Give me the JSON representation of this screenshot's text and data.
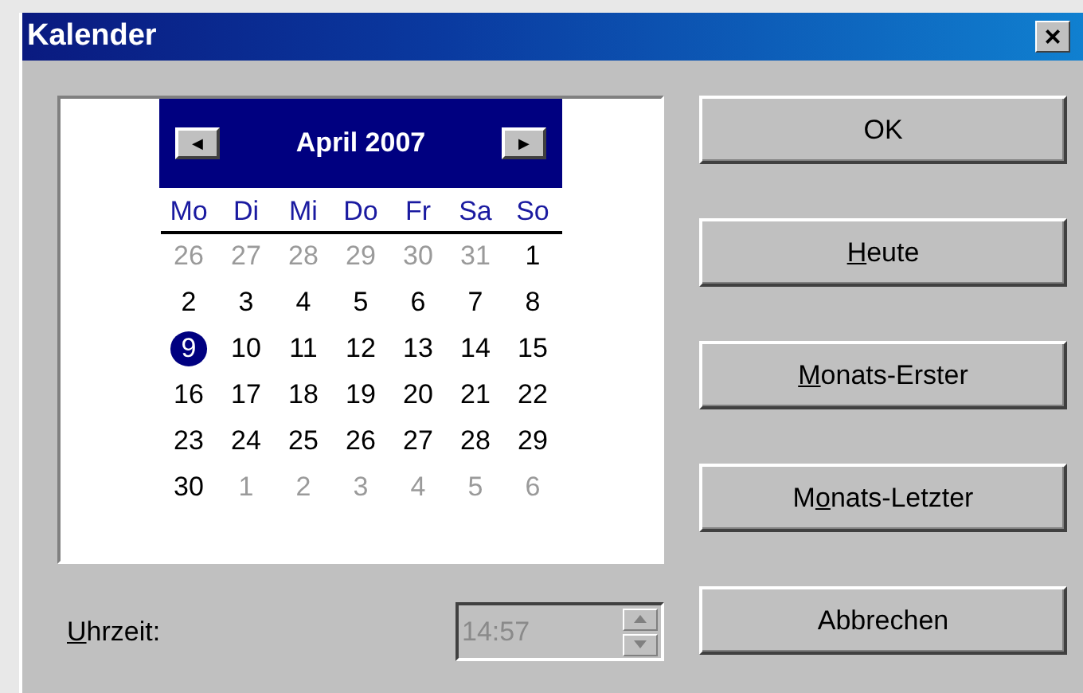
{
  "window": {
    "title": "Kalender",
    "close": "×"
  },
  "calendar": {
    "prev": "◀",
    "next": "▶",
    "month": "April 2007",
    "weekdays": [
      "Mo",
      "Di",
      "Mi",
      "Do",
      "Fr",
      "Sa",
      "So"
    ],
    "weeks": [
      [
        {
          "day": "26",
          "muted": true,
          "selected": false
        },
        {
          "day": "27",
          "muted": true,
          "selected": false
        },
        {
          "day": "28",
          "muted": true,
          "selected": false
        },
        {
          "day": "29",
          "muted": true,
          "selected": false
        },
        {
          "day": "30",
          "muted": true,
          "selected": false
        },
        {
          "day": "31",
          "muted": true,
          "selected": false
        },
        {
          "day": "1",
          "muted": false,
          "selected": false
        }
      ],
      [
        {
          "day": "2",
          "muted": false,
          "selected": false
        },
        {
          "day": "3",
          "muted": false,
          "selected": false
        },
        {
          "day": "4",
          "muted": false,
          "selected": false
        },
        {
          "day": "5",
          "muted": false,
          "selected": false
        },
        {
          "day": "6",
          "muted": false,
          "selected": false
        },
        {
          "day": "7",
          "muted": false,
          "selected": false
        },
        {
          "day": "8",
          "muted": false,
          "selected": false
        }
      ],
      [
        {
          "day": "9",
          "muted": false,
          "selected": true
        },
        {
          "day": "10",
          "muted": false,
          "selected": false
        },
        {
          "day": "11",
          "muted": false,
          "selected": false
        },
        {
          "day": "12",
          "muted": false,
          "selected": false
        },
        {
          "day": "13",
          "muted": false,
          "selected": false
        },
        {
          "day": "14",
          "muted": false,
          "selected": false
        },
        {
          "day": "15",
          "muted": false,
          "selected": false
        }
      ],
      [
        {
          "day": "16",
          "muted": false,
          "selected": false
        },
        {
          "day": "17",
          "muted": false,
          "selected": false
        },
        {
          "day": "18",
          "muted": false,
          "selected": false
        },
        {
          "day": "19",
          "muted": false,
          "selected": false
        },
        {
          "day": "20",
          "muted": false,
          "selected": false
        },
        {
          "day": "21",
          "muted": false,
          "selected": false
        },
        {
          "day": "22",
          "muted": false,
          "selected": false
        }
      ],
      [
        {
          "day": "23",
          "muted": false,
          "selected": false
        },
        {
          "day": "24",
          "muted": false,
          "selected": false
        },
        {
          "day": "25",
          "muted": false,
          "selected": false
        },
        {
          "day": "26",
          "muted": false,
          "selected": false
        },
        {
          "day": "27",
          "muted": false,
          "selected": false
        },
        {
          "day": "28",
          "muted": false,
          "selected": false
        },
        {
          "day": "29",
          "muted": false,
          "selected": false
        }
      ],
      [
        {
          "day": "30",
          "muted": false,
          "selected": false
        },
        {
          "day": "1",
          "muted": true,
          "selected": false
        },
        {
          "day": "2",
          "muted": true,
          "selected": false
        },
        {
          "day": "3",
          "muted": true,
          "selected": false
        },
        {
          "day": "4",
          "muted": true,
          "selected": false
        },
        {
          "day": "5",
          "muted": true,
          "selected": false
        },
        {
          "day": "6",
          "muted": true,
          "selected": false
        }
      ]
    ]
  },
  "time": {
    "label": {
      "key": "U",
      "after": "hrzeit:"
    },
    "value": "14:57",
    "disabled": true
  },
  "buttons": [
    {
      "after": "OK"
    },
    {
      "key": "H",
      "after": "eute"
    },
    {
      "key": "M",
      "after": "onats-Erster"
    },
    {
      "before": "M",
      "key": "o",
      "after": "nats-Letzter"
    },
    {
      "after": "Abbrechen"
    }
  ]
}
